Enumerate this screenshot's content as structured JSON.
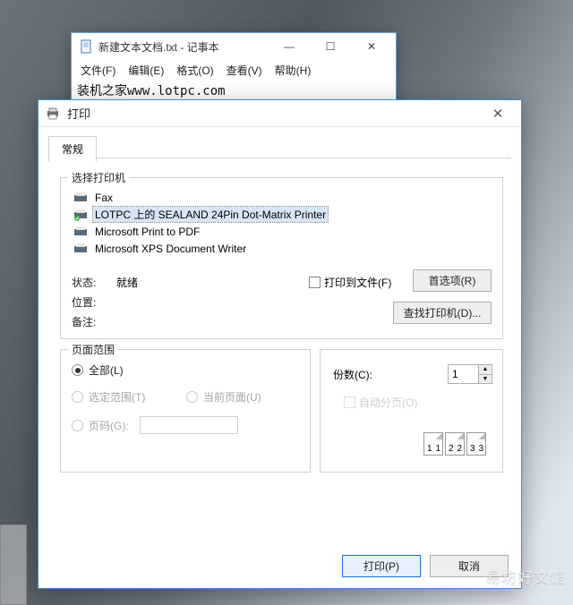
{
  "notepad": {
    "title": "新建文本文档.txt - 记事本",
    "menu": {
      "file": "文件(F)",
      "edit": "编辑(E)",
      "format": "格式(O)",
      "view": "查看(V)",
      "help": "帮助(H)"
    },
    "body": "装机之家www.lotpc.com"
  },
  "print": {
    "title": "打印",
    "tab_general": "常规",
    "select_printer_label": "选择打印机",
    "printers": {
      "fax": "Fax",
      "sealand": "LOTPC 上的 SEALAND 24Pin Dot-Matrix Printer",
      "mspdf": "Microsoft Print to PDF",
      "msxps": "Microsoft XPS Document Writer"
    },
    "status_label": "状态:",
    "status_value": "就绪",
    "location_label": "位置:",
    "comment_label": "备注:",
    "print_to_file": "打印到文件(F)",
    "preferences_btn": "首选项(R)",
    "find_printer_btn": "查找打印机(D)...",
    "range": {
      "group_label": "页面范围",
      "all": "全部(L)",
      "selection": "选定范围(T)",
      "current": "当前页面(U)",
      "pages": "页码(G):"
    },
    "copies": {
      "label": "份数(C):",
      "value": "1",
      "collate": "自动分页(O)",
      "p1": "1",
      "p2": "2",
      "p3": "3"
    },
    "buttons": {
      "print": "打印(P)",
      "cancel": "取消"
    }
  },
  "watermark": "易坊好文馆"
}
